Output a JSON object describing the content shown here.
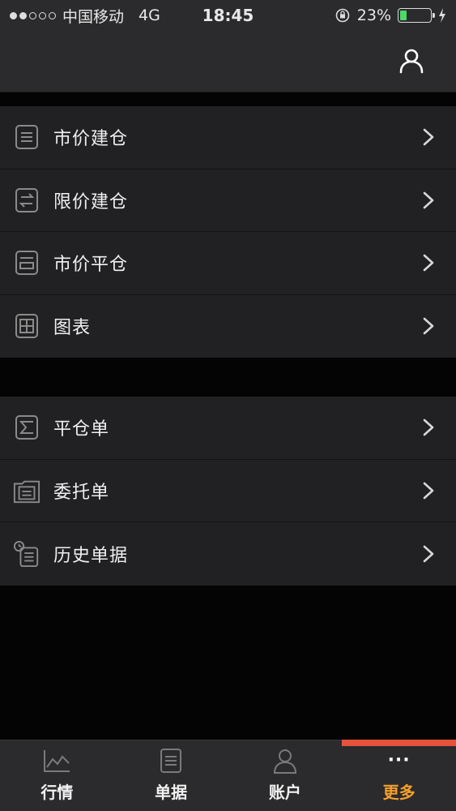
{
  "status_bar": {
    "carrier": "中国移动",
    "network": "4G",
    "time": "18:45",
    "battery": "23%",
    "battery_level": 0.23
  },
  "nav": {
    "user_icon": "user-icon"
  },
  "menu_group_1": [
    {
      "label": "市价建仓",
      "icon": "list-doc-icon"
    },
    {
      "label": "限价建仓",
      "icon": "swap-arrows-icon"
    },
    {
      "label": "市价平仓",
      "icon": "tray-icon"
    },
    {
      "label": "图表",
      "icon": "grid-icon"
    }
  ],
  "menu_group_2": [
    {
      "label": "平仓单",
      "icon": "close-order-icon"
    },
    {
      "label": "委托单",
      "icon": "folder-doc-icon"
    },
    {
      "label": "历史单据",
      "icon": "history-doc-icon"
    }
  ],
  "tabs": [
    {
      "label": "行情",
      "icon": "chart-line-icon",
      "active": false
    },
    {
      "label": "单据",
      "icon": "document-icon",
      "active": false
    },
    {
      "label": "账户",
      "icon": "account-icon",
      "active": false
    },
    {
      "label": "更多",
      "icon": "more-dots-icon",
      "active": true,
      "dots": "···"
    }
  ],
  "colors": {
    "active_tab_text": "#f4a02a",
    "active_tab_indicator": "#e5533c",
    "battery": "#4cd964"
  }
}
